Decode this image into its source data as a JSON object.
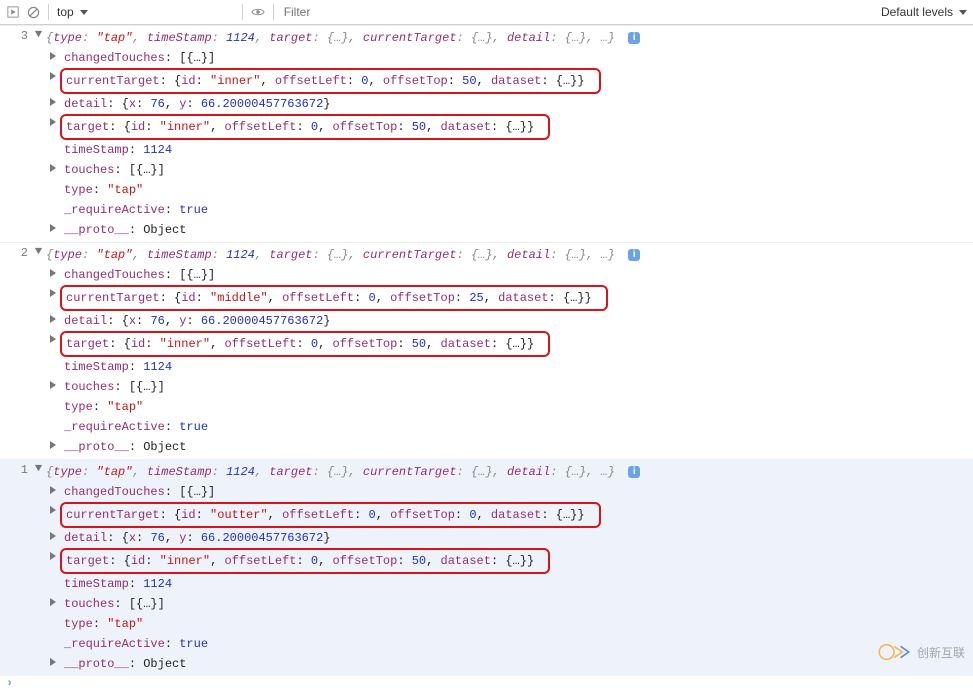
{
  "toolbar": {
    "context": "top",
    "filter_placeholder": "Filter",
    "levels": "Default levels"
  },
  "icons": {
    "play": "▶",
    "stop": "⦸",
    "eye": "👁",
    "info": "i"
  },
  "entries": [
    {
      "gutter": "3",
      "selected": false,
      "preview": "{type: \"tap\", timeStamp: 1124, target: {…}, currentTarget: {…}, detail: {…}, …}",
      "rows": [
        {
          "tri": true,
          "hl": false,
          "parts": [
            [
              "k",
              "changedTouches"
            ],
            [
              "p",
              ": [{…}]"
            ]
          ]
        },
        {
          "tri": true,
          "hl": true,
          "parts": [
            [
              "k",
              "currentTarget"
            ],
            [
              "p",
              ": {"
            ],
            [
              "k",
              "id"
            ],
            [
              "p",
              ": "
            ],
            [
              "s",
              "\"inner\""
            ],
            [
              "p",
              ", "
            ],
            [
              "k",
              "offsetLeft"
            ],
            [
              "p",
              ": "
            ],
            [
              "n",
              "0"
            ],
            [
              "p",
              ", "
            ],
            [
              "k",
              "offsetTop"
            ],
            [
              "p",
              ": "
            ],
            [
              "n",
              "50"
            ],
            [
              "p",
              ", "
            ],
            [
              "k",
              "dataset"
            ],
            [
              "p",
              ": {…}}"
            ]
          ]
        },
        {
          "tri": true,
          "hl": false,
          "parts": [
            [
              "k",
              "detail"
            ],
            [
              "p",
              ": {"
            ],
            [
              "k",
              "x"
            ],
            [
              "p",
              ": "
            ],
            [
              "n",
              "76"
            ],
            [
              "p",
              ", "
            ],
            [
              "k",
              "y"
            ],
            [
              "p",
              ": "
            ],
            [
              "n",
              "66.20000457763672"
            ],
            [
              "p",
              "}"
            ]
          ]
        },
        {
          "tri": true,
          "hl": true,
          "parts": [
            [
              "k",
              "target"
            ],
            [
              "p",
              ": {"
            ],
            [
              "k",
              "id"
            ],
            [
              "p",
              ": "
            ],
            [
              "s",
              "\"inner\""
            ],
            [
              "p",
              ", "
            ],
            [
              "k",
              "offsetLeft"
            ],
            [
              "p",
              ": "
            ],
            [
              "n",
              "0"
            ],
            [
              "p",
              ", "
            ],
            [
              "k",
              "offsetTop"
            ],
            [
              "p",
              ": "
            ],
            [
              "n",
              "50"
            ],
            [
              "p",
              ", "
            ],
            [
              "k",
              "dataset"
            ],
            [
              "p",
              ": {…}}"
            ]
          ]
        },
        {
          "tri": false,
          "hl": false,
          "parts": [
            [
              "k",
              "timeStamp"
            ],
            [
              "p",
              ": "
            ],
            [
              "n",
              "1124"
            ]
          ]
        },
        {
          "tri": true,
          "hl": false,
          "parts": [
            [
              "k",
              "touches"
            ],
            [
              "p",
              ": [{…}]"
            ]
          ]
        },
        {
          "tri": false,
          "hl": false,
          "parts": [
            [
              "k",
              "type"
            ],
            [
              "p",
              ": "
            ],
            [
              "s",
              "\"tap\""
            ]
          ]
        },
        {
          "tri": false,
          "hl": false,
          "parts": [
            [
              "k",
              "_requireActive"
            ],
            [
              "p",
              ": "
            ],
            [
              "n",
              "true"
            ]
          ]
        },
        {
          "tri": true,
          "hl": false,
          "parts": [
            [
              "k",
              "__proto__"
            ],
            [
              "p",
              ": Object"
            ]
          ]
        }
      ]
    },
    {
      "gutter": "2",
      "selected": false,
      "preview": "{type: \"tap\", timeStamp: 1124, target: {…}, currentTarget: {…}, detail: {…}, …}",
      "rows": [
        {
          "tri": true,
          "hl": false,
          "parts": [
            [
              "k",
              "changedTouches"
            ],
            [
              "p",
              ": [{…}]"
            ]
          ]
        },
        {
          "tri": true,
          "hl": true,
          "parts": [
            [
              "k",
              "currentTarget"
            ],
            [
              "p",
              ": {"
            ],
            [
              "k",
              "id"
            ],
            [
              "p",
              ": "
            ],
            [
              "s",
              "\"middle\""
            ],
            [
              "p",
              ", "
            ],
            [
              "k",
              "offsetLeft"
            ],
            [
              "p",
              ": "
            ],
            [
              "n",
              "0"
            ],
            [
              "p",
              ", "
            ],
            [
              "k",
              "offsetTop"
            ],
            [
              "p",
              ": "
            ],
            [
              "n",
              "25"
            ],
            [
              "p",
              ", "
            ],
            [
              "k",
              "dataset"
            ],
            [
              "p",
              ": {…}}"
            ]
          ]
        },
        {
          "tri": true,
          "hl": false,
          "parts": [
            [
              "k",
              "detail"
            ],
            [
              "p",
              ": {"
            ],
            [
              "k",
              "x"
            ],
            [
              "p",
              ": "
            ],
            [
              "n",
              "76"
            ],
            [
              "p",
              ", "
            ],
            [
              "k",
              "y"
            ],
            [
              "p",
              ": "
            ],
            [
              "n",
              "66.20000457763672"
            ],
            [
              "p",
              "}"
            ]
          ]
        },
        {
          "tri": true,
          "hl": true,
          "parts": [
            [
              "k",
              "target"
            ],
            [
              "p",
              ": {"
            ],
            [
              "k",
              "id"
            ],
            [
              "p",
              ": "
            ],
            [
              "s",
              "\"inner\""
            ],
            [
              "p",
              ", "
            ],
            [
              "k",
              "offsetLeft"
            ],
            [
              "p",
              ": "
            ],
            [
              "n",
              "0"
            ],
            [
              "p",
              ", "
            ],
            [
              "k",
              "offsetTop"
            ],
            [
              "p",
              ": "
            ],
            [
              "n",
              "50"
            ],
            [
              "p",
              ", "
            ],
            [
              "k",
              "dataset"
            ],
            [
              "p",
              ": {…}}"
            ]
          ]
        },
        {
          "tri": false,
          "hl": false,
          "parts": [
            [
              "k",
              "timeStamp"
            ],
            [
              "p",
              ": "
            ],
            [
              "n",
              "1124"
            ]
          ]
        },
        {
          "tri": true,
          "hl": false,
          "parts": [
            [
              "k",
              "touches"
            ],
            [
              "p",
              ": [{…}]"
            ]
          ]
        },
        {
          "tri": false,
          "hl": false,
          "parts": [
            [
              "k",
              "type"
            ],
            [
              "p",
              ": "
            ],
            [
              "s",
              "\"tap\""
            ]
          ]
        },
        {
          "tri": false,
          "hl": false,
          "parts": [
            [
              "k",
              "_requireActive"
            ],
            [
              "p",
              ": "
            ],
            [
              "n",
              "true"
            ]
          ]
        },
        {
          "tri": true,
          "hl": false,
          "parts": [
            [
              "k",
              "__proto__"
            ],
            [
              "p",
              ": Object"
            ]
          ]
        }
      ]
    },
    {
      "gutter": "1",
      "selected": true,
      "preview": "{type: \"tap\", timeStamp: 1124, target: {…}, currentTarget: {…}, detail: {…}, …}",
      "rows": [
        {
          "tri": true,
          "hl": false,
          "parts": [
            [
              "k",
              "changedTouches"
            ],
            [
              "p",
              ": [{…}]"
            ]
          ]
        },
        {
          "tri": true,
          "hl": true,
          "parts": [
            [
              "k",
              "currentTarget"
            ],
            [
              "p",
              ": {"
            ],
            [
              "k",
              "id"
            ],
            [
              "p",
              ": "
            ],
            [
              "s",
              "\"outter\""
            ],
            [
              "p",
              ", "
            ],
            [
              "k",
              "offsetLeft"
            ],
            [
              "p",
              ": "
            ],
            [
              "n",
              "0"
            ],
            [
              "p",
              ", "
            ],
            [
              "k",
              "offsetTop"
            ],
            [
              "p",
              ": "
            ],
            [
              "n",
              "0"
            ],
            [
              "p",
              ", "
            ],
            [
              "k",
              "dataset"
            ],
            [
              "p",
              ": {…}}"
            ]
          ]
        },
        {
          "tri": true,
          "hl": false,
          "parts": [
            [
              "k",
              "detail"
            ],
            [
              "p",
              ": {"
            ],
            [
              "k",
              "x"
            ],
            [
              "p",
              ": "
            ],
            [
              "n",
              "76"
            ],
            [
              "p",
              ", "
            ],
            [
              "k",
              "y"
            ],
            [
              "p",
              ": "
            ],
            [
              "n",
              "66.20000457763672"
            ],
            [
              "p",
              "}"
            ]
          ]
        },
        {
          "tri": true,
          "hl": true,
          "parts": [
            [
              "k",
              "target"
            ],
            [
              "p",
              ": {"
            ],
            [
              "k",
              "id"
            ],
            [
              "p",
              ": "
            ],
            [
              "s",
              "\"inner\""
            ],
            [
              "p",
              ", "
            ],
            [
              "k",
              "offsetLeft"
            ],
            [
              "p",
              ": "
            ],
            [
              "n",
              "0"
            ],
            [
              "p",
              ", "
            ],
            [
              "k",
              "offsetTop"
            ],
            [
              "p",
              ": "
            ],
            [
              "n",
              "50"
            ],
            [
              "p",
              ", "
            ],
            [
              "k",
              "dataset"
            ],
            [
              "p",
              ": {…}}"
            ]
          ]
        },
        {
          "tri": false,
          "hl": false,
          "parts": [
            [
              "k",
              "timeStamp"
            ],
            [
              "p",
              ": "
            ],
            [
              "n",
              "1124"
            ]
          ]
        },
        {
          "tri": true,
          "hl": false,
          "parts": [
            [
              "k",
              "touches"
            ],
            [
              "p",
              ": [{…}]"
            ]
          ]
        },
        {
          "tri": false,
          "hl": false,
          "parts": [
            [
              "k",
              "type"
            ],
            [
              "p",
              ": "
            ],
            [
              "s",
              "\"tap\""
            ]
          ]
        },
        {
          "tri": false,
          "hl": false,
          "parts": [
            [
              "k",
              "_requireActive"
            ],
            [
              "p",
              ": "
            ],
            [
              "n",
              "true"
            ]
          ]
        },
        {
          "tri": true,
          "hl": false,
          "parts": [
            [
              "k",
              "__proto__"
            ],
            [
              "p",
              ": Object"
            ]
          ]
        }
      ]
    }
  ],
  "watermark": {
    "text": "创新互联"
  }
}
